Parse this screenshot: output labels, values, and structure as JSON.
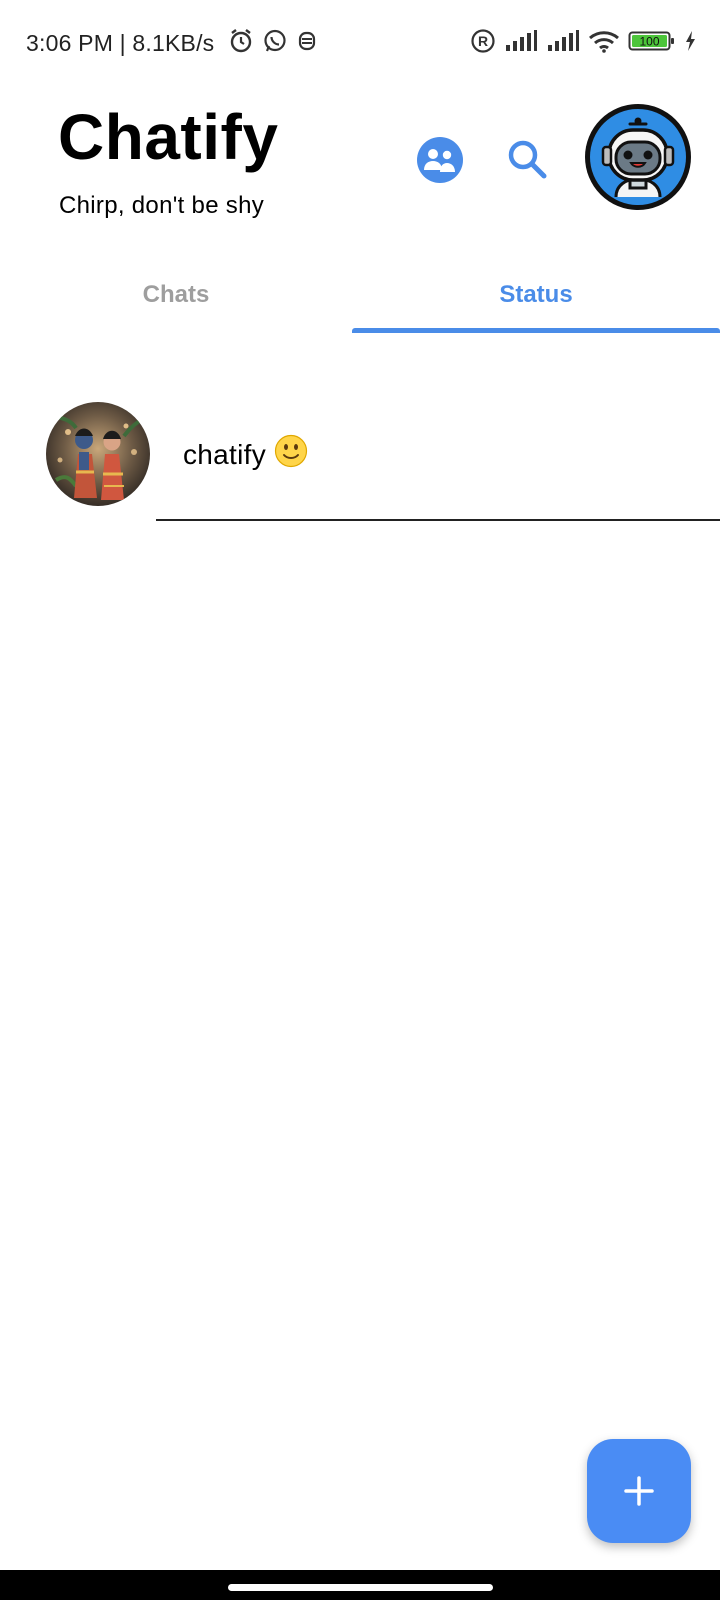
{
  "status_bar": {
    "time": "3:06 PM | 8.1KB/s",
    "battery": "100",
    "icons": [
      "alarm-icon",
      "whatsapp-icon",
      "notification-icon",
      "registered-icon",
      "signal-icon",
      "signal-icon",
      "wifi-icon",
      "battery-icon",
      "charging-icon"
    ]
  },
  "header": {
    "title": "Chatify",
    "subtitle": "Chirp, don't be shy",
    "actions": [
      "people-icon",
      "search-icon",
      "profile-avatar"
    ]
  },
  "tabs": [
    {
      "label": "Chats",
      "active": false
    },
    {
      "label": "Status",
      "active": true
    }
  ],
  "status_list": [
    {
      "name": "chatify",
      "emoji": "🙂"
    }
  ],
  "fab": {
    "icon": "plus-icon"
  },
  "colors": {
    "accent": "#4a8ce8",
    "inactive_tab": "#9e9e9e",
    "fab": "#4a8cf4"
  }
}
